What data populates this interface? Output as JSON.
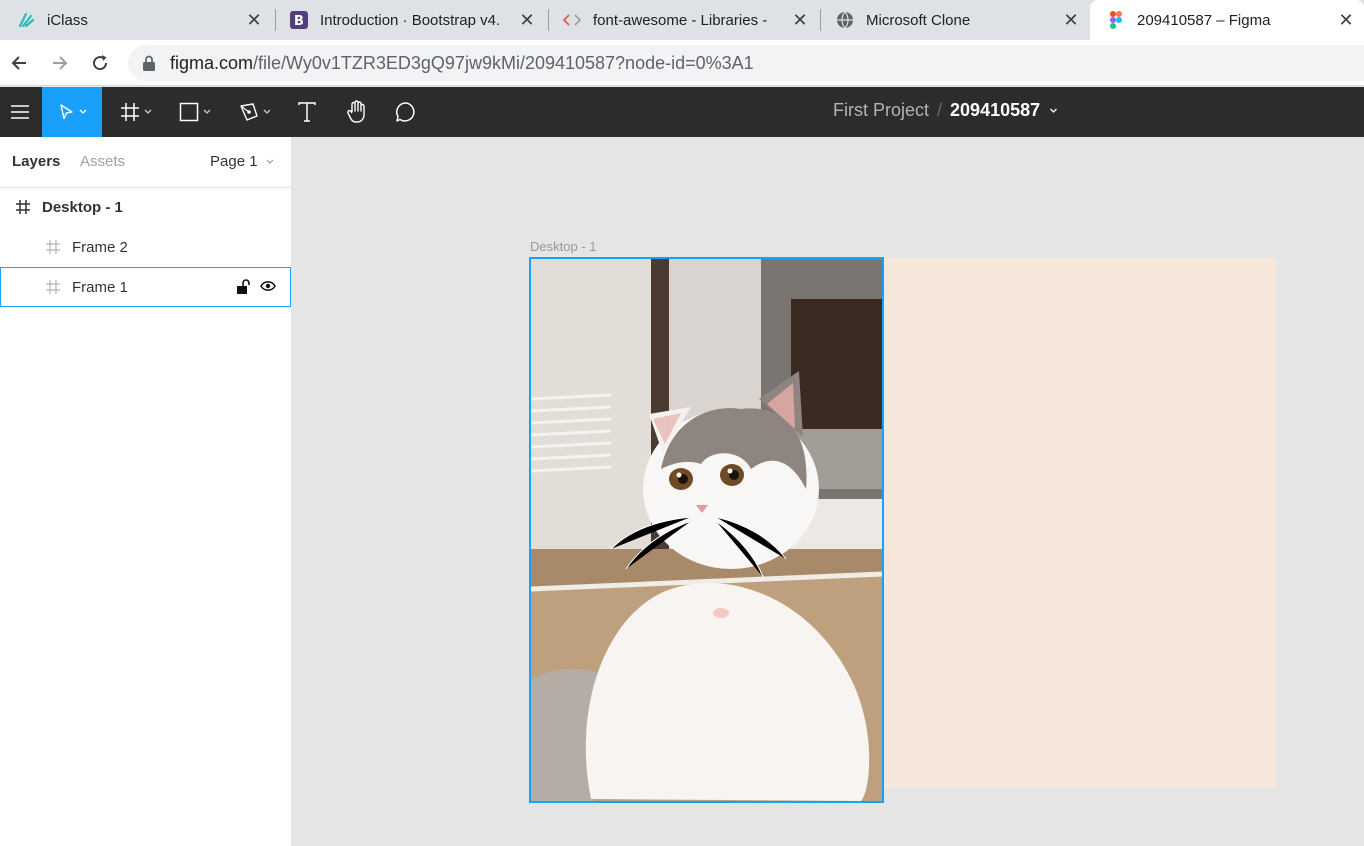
{
  "browser": {
    "tabs": [
      {
        "title": "iClass",
        "favicon": "iclass-icon"
      },
      {
        "title": "Introduction · Bootstrap v4.",
        "favicon": "bootstrap-icon"
      },
      {
        "title": "font-awesome - Libraries -",
        "favicon": "code-icon"
      },
      {
        "title": "Microsoft Clone",
        "favicon": "globe-icon"
      },
      {
        "title": "209410587 – Figma",
        "favicon": "figma-icon",
        "active": true
      }
    ],
    "close_glyph": "✕",
    "address": {
      "host": "figma.com",
      "path": "/file/Wy0v1TZR3ED3gQ97jw9kMi/209410587?node-id=0%3A1"
    }
  },
  "figma": {
    "project_name": "First Project",
    "separator": "/",
    "file_name": "209410587",
    "tools": [
      "menu-icon",
      "move-tool",
      "frame-tool",
      "shape-tool",
      "pen-tool",
      "text-tool",
      "hand-tool",
      "comment-tool"
    ],
    "accent": "#18a0fb",
    "toolbar_bg": "#2c2c2c"
  },
  "left_panel": {
    "tab_layers": "Layers",
    "tab_assets": "Assets",
    "page_selector": "Page 1",
    "layers": [
      {
        "name": "Desktop - 1",
        "level": 0
      },
      {
        "name": "Frame 2",
        "level": 1
      },
      {
        "name": "Frame 1",
        "level": 1,
        "selected": true
      }
    ]
  },
  "canvas": {
    "frame_label": "Desktop - 1",
    "frame2_fill": "#f5e8db",
    "photo_subject": "cat-photo"
  }
}
